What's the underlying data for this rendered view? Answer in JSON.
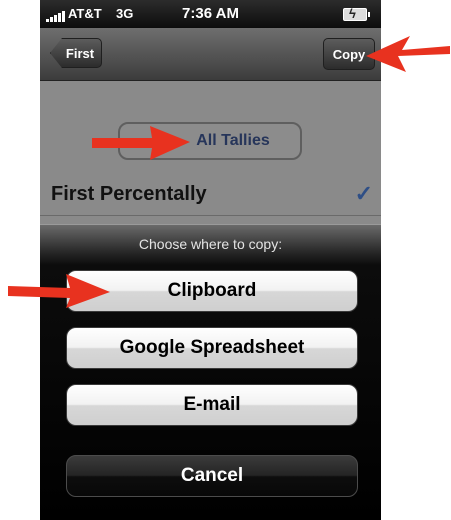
{
  "status_bar": {
    "carrier": "AT&T",
    "network": "3G",
    "time": "7:36 AM"
  },
  "nav": {
    "back_label": "First",
    "copy_label": "Copy"
  },
  "content": {
    "all_tallies_label": "All Tallies",
    "setting_label": "First Percentally",
    "checked": true
  },
  "action_sheet": {
    "title": "Choose where to copy:",
    "buttons": [
      "Clipboard",
      "Google Spreadsheet",
      "E-mail"
    ],
    "cancel_label": "Cancel"
  },
  "colors": {
    "annotation_arrow": "#e8321f",
    "checkmark": "#2f4f86"
  }
}
